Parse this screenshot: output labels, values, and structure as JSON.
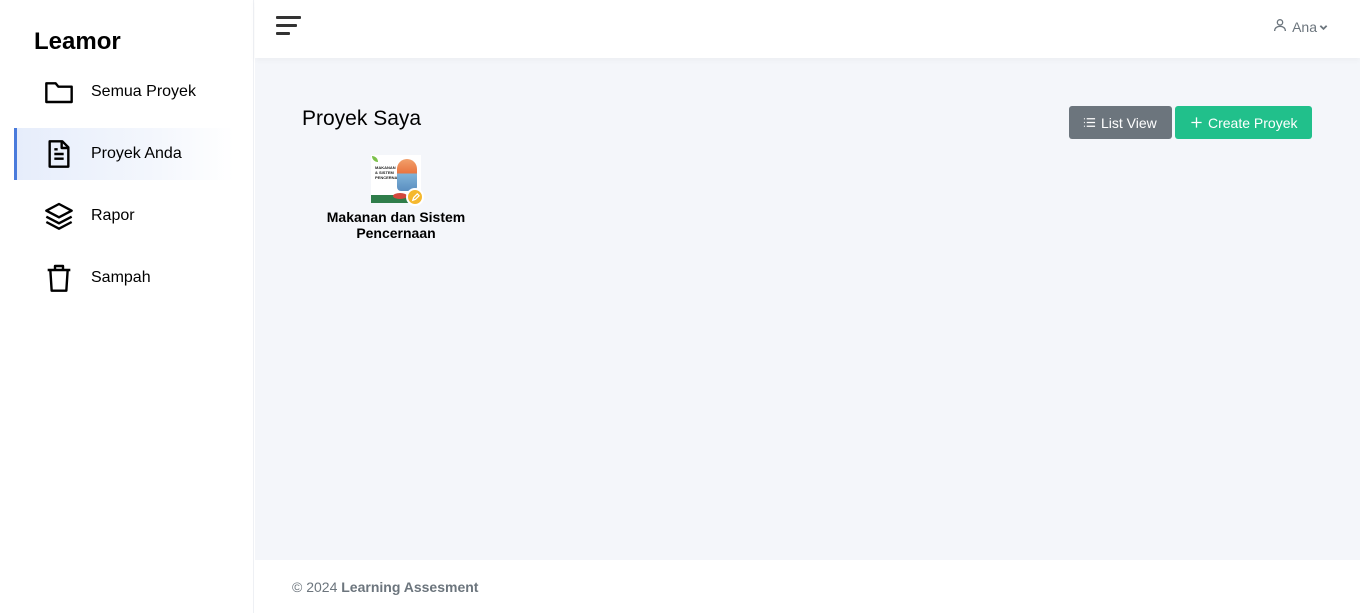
{
  "brand": "Leamor",
  "sidebar": {
    "items": [
      {
        "label": "Semua Proyek",
        "icon": "folder-icon",
        "active": false
      },
      {
        "label": "Proyek Anda",
        "icon": "document-icon",
        "active": true
      },
      {
        "label": "Rapor",
        "icon": "layers-icon",
        "active": false
      },
      {
        "label": "Sampah",
        "icon": "trash-icon",
        "active": false
      }
    ]
  },
  "topbar": {
    "menu_icon": "hamburger-menu-icon",
    "user_name": "Ana",
    "user_icon": "user-icon"
  },
  "main": {
    "title": "Proyek Saya",
    "list_view_label": "List View",
    "create_label": "Create Proyek",
    "projects": [
      {
        "name": "Makanan dan Sistem Pencernaan",
        "thumbnail_text": "MAKANAN & SISTEM PENCERNAAN",
        "badge_icon": "edit-icon"
      }
    ]
  },
  "footer": {
    "copyright": "© 2024",
    "org": "Learning Assesment"
  },
  "colors": {
    "accent_blue": "#4a7bdc",
    "btn_gray": "#6c757d",
    "btn_green": "#21c08b",
    "main_bg": "#f4f6fa"
  }
}
